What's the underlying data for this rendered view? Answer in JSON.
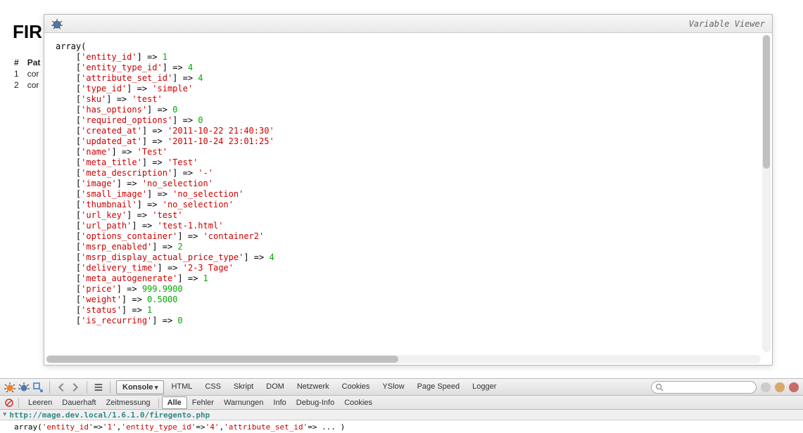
{
  "page": {
    "heading_fragment": "FIR"
  },
  "bg_table": {
    "headers": [
      "#",
      "Pat"
    ],
    "rows": [
      [
        "1",
        "cor"
      ],
      [
        "2",
        "cor"
      ]
    ]
  },
  "viewer": {
    "title": "Variable Viewer",
    "root_label": "array(",
    "entries": [
      {
        "key": "'entity_id'",
        "value": "1",
        "type": "num"
      },
      {
        "key": "'entity_type_id'",
        "value": "4",
        "type": "num"
      },
      {
        "key": "'attribute_set_id'",
        "value": "4",
        "type": "num"
      },
      {
        "key": "'type_id'",
        "value": "'simple'",
        "type": "str"
      },
      {
        "key": "'sku'",
        "value": "'test'",
        "type": "str"
      },
      {
        "key": "'has_options'",
        "value": "0",
        "type": "num"
      },
      {
        "key": "'required_options'",
        "value": "0",
        "type": "num"
      },
      {
        "key": "'created_at'",
        "value": "'2011-10-22 21:40:30'",
        "type": "str"
      },
      {
        "key": "'updated_at'",
        "value": "'2011-10-24 23:01:25'",
        "type": "str"
      },
      {
        "key": "'name'",
        "value": "'Test'",
        "type": "str"
      },
      {
        "key": "'meta_title'",
        "value": "'Test'",
        "type": "str"
      },
      {
        "key": "'meta_description'",
        "value": "'-'",
        "type": "str"
      },
      {
        "key": "'image'",
        "value": "'no_selection'",
        "type": "str"
      },
      {
        "key": "'small_image'",
        "value": "'no_selection'",
        "type": "str"
      },
      {
        "key": "'thumbnail'",
        "value": "'no_selection'",
        "type": "str"
      },
      {
        "key": "'url_key'",
        "value": "'test'",
        "type": "str"
      },
      {
        "key": "'url_path'",
        "value": "'test-1.html'",
        "type": "str"
      },
      {
        "key": "'options_container'",
        "value": "'container2'",
        "type": "str"
      },
      {
        "key": "'msrp_enabled'",
        "value": "2",
        "type": "num"
      },
      {
        "key": "'msrp_display_actual_price_type'",
        "value": "4",
        "type": "num"
      },
      {
        "key": "'delivery_time'",
        "value": "'2-3 Tage'",
        "type": "str"
      },
      {
        "key": "'meta_autogenerate'",
        "value": "1",
        "type": "num"
      },
      {
        "key": "'price'",
        "value": "999.9900",
        "type": "num"
      },
      {
        "key": "'weight'",
        "value": "0.5000",
        "type": "num"
      },
      {
        "key": "'status'",
        "value": "1",
        "type": "num"
      },
      {
        "key": "'is_recurring'",
        "value": "0",
        "type": "num"
      }
    ]
  },
  "firebug": {
    "main_tabs": [
      "Konsole",
      "HTML",
      "CSS",
      "Skript",
      "DOM",
      "Netzwerk",
      "Cookies",
      "YSlow",
      "Page Speed",
      "Logger"
    ],
    "main_active": "Konsole",
    "sub_items": [
      "Leeren",
      "Dauerhaft",
      "Zeitmessung",
      "Alle",
      "Fehler",
      "Warnungen",
      "Info",
      "Debug-Info",
      "Cookies"
    ],
    "sub_active": "Alle",
    "search_placeholder": "",
    "request_url": "http://mage.dev.local/1.6.1.0/firegento.php",
    "console_line": {
      "prefix": "array(",
      "parts": [
        {
          "k": "'entity_id'",
          "v": "'1'"
        },
        {
          "k": "'entity_type_id'",
          "v": "'4'"
        },
        {
          "k": "'attribute_set_id'",
          "v": " ... "
        }
      ],
      "suffix": ")"
    }
  }
}
